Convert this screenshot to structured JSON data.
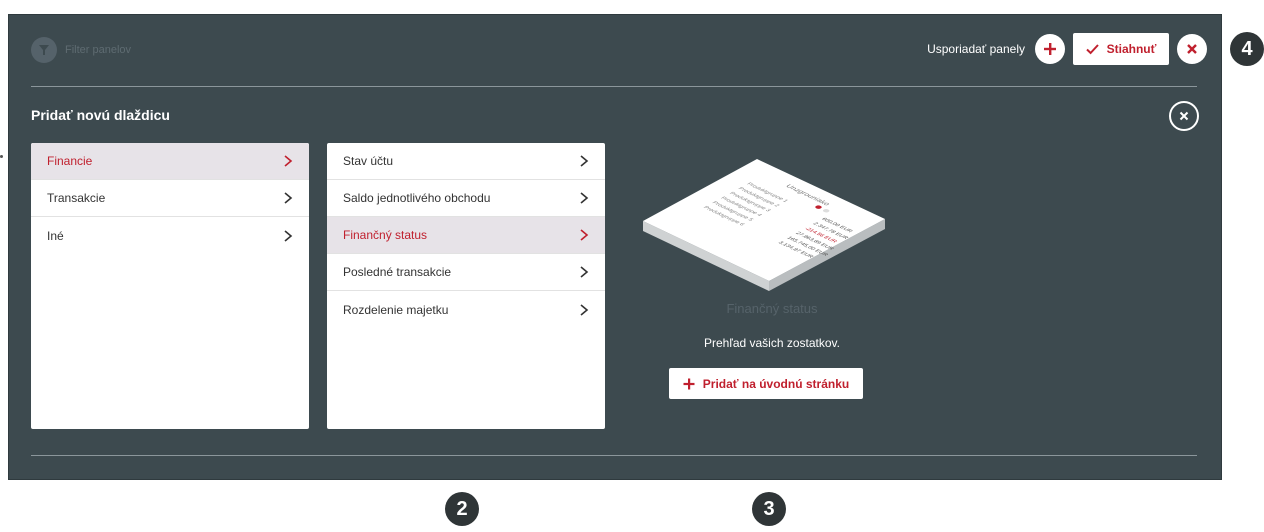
{
  "header": {
    "filter_label": "Filter panelov",
    "arrange_label": "Usporiadať panely",
    "download_label": "Stiahnuť"
  },
  "section": {
    "title": "Pridať novú dlaždicu"
  },
  "categories": [
    {
      "label": "Financie",
      "active": true
    },
    {
      "label": "Transakcie",
      "active": false
    },
    {
      "label": "Iné",
      "active": false
    }
  ],
  "tiles": [
    {
      "label": "Stav účtu",
      "active": false
    },
    {
      "label": "Saldo jednotlivého obchodu",
      "active": false
    },
    {
      "label": "Finančný status",
      "active": true
    },
    {
      "label": "Posledné transakcie",
      "active": false
    },
    {
      "label": "Rozdelenie majetku",
      "active": false
    }
  ],
  "preview": {
    "title": "Finančný status",
    "description": "Prehľad vašich zostatkov.",
    "add_button": "Pridať na úvodnú stránku",
    "mini_title": "Unzgrouniako",
    "mini_rows": [
      {
        "label": "Produktgruppe 1",
        "value": "600,00 EUR"
      },
      {
        "label": "Produktgruppe 2",
        "value": "2.347,78 EUR"
      },
      {
        "label": "Produktgruppe 3",
        "value": "-214,56 EUR"
      },
      {
        "label": "Produktgruppe 4",
        "value": "27.863,89 EUR"
      },
      {
        "label": "Produktgruppe 5",
        "value": "165.745,00 EUR"
      },
      {
        "label": "Produktgruppe 6",
        "value": "3.134,87 EUR"
      }
    ]
  },
  "badges": {
    "b2": "2",
    "b3": "3",
    "b4": "4"
  },
  "colors": {
    "panel_bg": "#3d4a4f",
    "accent_red": "#c0202e",
    "active_row_bg": "#e7e3e8"
  },
  "icons": {
    "filter": "filter-icon",
    "plus": "plus-icon",
    "check": "check-icon",
    "close": "close-icon",
    "chevron": "chevron-right-icon"
  }
}
